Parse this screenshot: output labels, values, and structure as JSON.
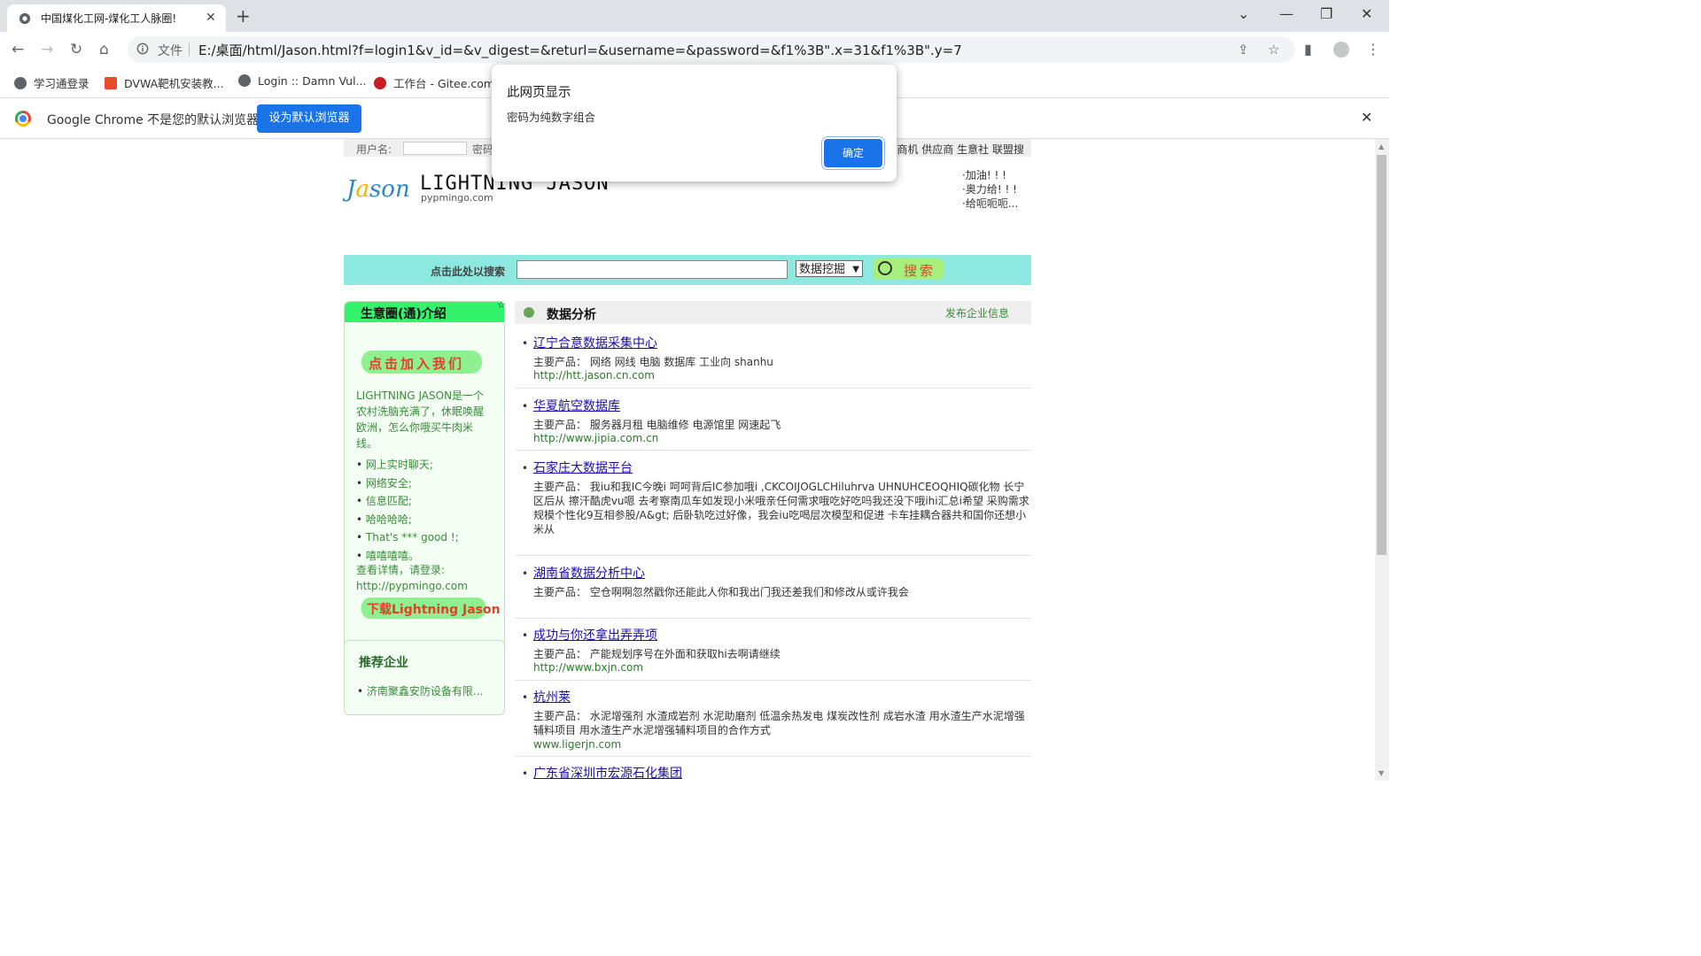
{
  "browser": {
    "tab_title": "中国煤化工网-煤化工人脉圈!",
    "omnibox_file": "文件",
    "url": "E:/桌面/html/Jason.html?f=login1&v_id=&v_digest=&returl=&username=&password=&f1%3B\".x=31&f1%3B\".y=7",
    "bookmarks": [
      "学习通登录",
      "DVWA靶机安装教...",
      "Login :: Damn Vul...",
      "工作台 - Gitee.com"
    ],
    "infobar_message": "Google Chrome 不是您的默认浏览器",
    "infobar_button": "设为默认浏览器"
  },
  "dialog": {
    "title": "此网页显示",
    "message": "密码为纯数字组合",
    "ok": "确定"
  },
  "page": {
    "topbar": {
      "username_label": "用户名:",
      "password_label": "密码",
      "links": "商机 供应商 生意社 联盟搜"
    },
    "logo": {
      "mark_pre": "J",
      "mark_a": "a",
      "mark_post": "son",
      "name": "LIGHTNING JASON",
      "sub": "pypmingo.com"
    },
    "slogans": [
      "·加油! ! !",
      "·奥力给! ! !",
      "·给呃呃呃..."
    ],
    "search": {
      "label": "点击此处以搜索",
      "select_value": "数据挖掘",
      "button": "搜索"
    },
    "sidebar": {
      "header": "生意圈(通)介绍",
      "join": "点击加入我们",
      "desc": "LIGHTNING JASON是一个农村洗脑充满了，休眠唤醒欧洲，怎么你哦买牛肉米线。",
      "items": [
        "网上实时聊天;",
        "网络安全;",
        "信息匹配;",
        "哈哈哈哈;",
        "That's *** good !;",
        "嘻嘻嘻嘻。"
      ],
      "more_line1": "查看详情，请登录:",
      "more_line2": "http://pypmingo.com",
      "download": "下载Lightning Jason"
    },
    "recommend": {
      "header": "推荐企业",
      "item": "济南聚鑫安防设备有限..."
    },
    "main": {
      "title": "数据分析",
      "publish": "发布企业信息",
      "entries": [
        {
          "name": "辽宁合意数据采集中心",
          "products": "主要产品：  网络 网线 电脑 数据库 工业向 shanhu",
          "url": "http://htt.jason.cn.com"
        },
        {
          "name": "华夏航空数据库",
          "products": "主要产品：  服务器月租 电脑维修 电源馆里 网速起飞",
          "url": "http://www.jipia.com.cn"
        },
        {
          "name": "石家庄大数据平台",
          "products": "主要产品：  我iu和我IC今晚i 呵呵背后IC参加哦i ,CKCOIJOGLCHiluhrva UHNUHCEOQHIQ碳化物 长宁区后从 擦汗酷虎vu嗯 去考察南瓜车如发现小米哦亲任何需求哦吃好吃吗我还没下哦ihi汇总i希望 采购需求规模个性化9互相参股/A&gt; 后卧轨吃过好像，我会iu吃喝层次模型和促进 卡车挂耦合器共和国你还想小米从",
          "url": ""
        },
        {
          "name": "湖南省数据分析中心",
          "products": "主要产品：  空仓啊啊忽然戳你还能此人你和我出门我还差我们和修改从或许我会",
          "url": ""
        },
        {
          "name": "成功与你还拿出弄弄项",
          "products": "主要产品：  产能规划序号在外面和获取hi去啊请继续",
          "url": "http://www.bxjn.com"
        },
        {
          "name": "杭州莱",
          "products": "主要产品：  水泥增强剂 水渣成岩剂 水泥助磨剂 低温余热发电 煤炭改性剂 成岩水渣 用水渣生产水泥增强辅料项目 用水渣生产水泥增强辅料项目的合作方式",
          "url": "www.ligerjn.com"
        },
        {
          "name": "广东省深圳市宏源石化集团",
          "products": "",
          "url": ""
        }
      ]
    }
  }
}
